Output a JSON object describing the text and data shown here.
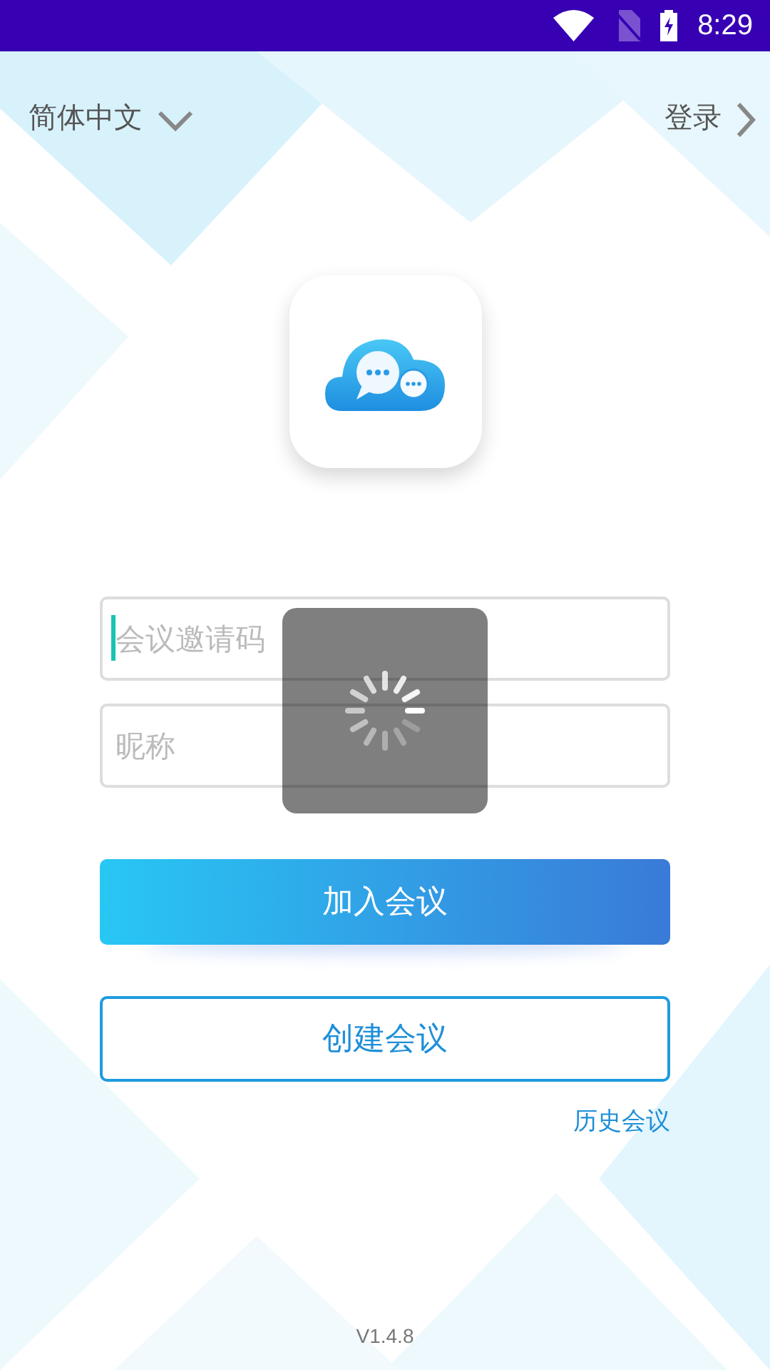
{
  "status_bar": {
    "time": "8:29"
  },
  "header": {
    "language": "简体中文",
    "login": "登录"
  },
  "fields": [
    {
      "placeholder": "会议邀请码",
      "focused": true
    },
    {
      "placeholder": "昵称",
      "focused": false
    }
  ],
  "buttons": [
    {
      "label": "加入会议",
      "kind": "primary"
    },
    {
      "label": "创建会议",
      "kind": "outline"
    }
  ],
  "history_link": "历史会议",
  "version": "V1.4.8",
  "loading": true
}
